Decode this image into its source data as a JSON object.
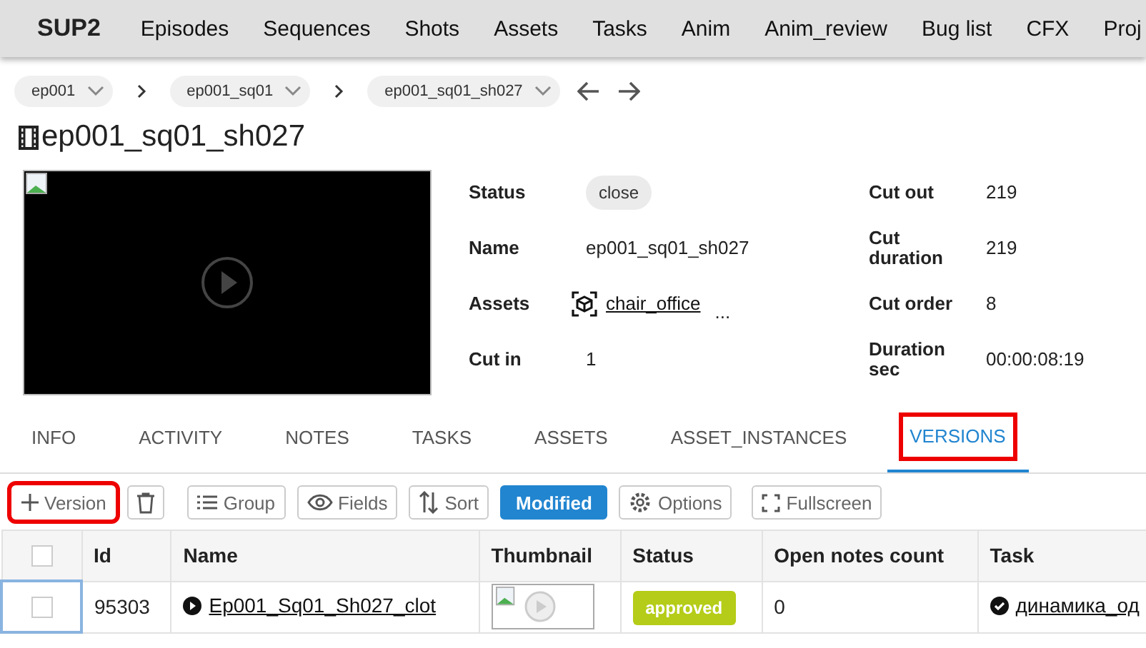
{
  "nav": {
    "brand": "SUP2",
    "items": [
      "Episodes",
      "Sequences",
      "Shots",
      "Assets",
      "Tasks",
      "Anim",
      "Anim_review",
      "Bug list",
      "CFX",
      "Proj"
    ]
  },
  "breadcrumbs": [
    "ep001",
    "ep001_sq01",
    "ep001_sq01_sh027"
  ],
  "title": "ep001_sq01_sh027",
  "info": {
    "left": [
      {
        "label": "Status",
        "kind": "chip",
        "value": "close"
      },
      {
        "label": "Name",
        "kind": "text",
        "value": "ep001_sq01_sh027"
      },
      {
        "label": "Assets",
        "kind": "asset",
        "value": "chair_office",
        "more": "..."
      },
      {
        "label": "Cut in",
        "kind": "text",
        "value": "1"
      }
    ],
    "right": [
      {
        "label": "Cut out",
        "value": "219"
      },
      {
        "label": "Cut duration",
        "value": "219"
      },
      {
        "label": "Cut order",
        "value": "8"
      },
      {
        "label": "Duration sec",
        "value": "00:00:08:19"
      }
    ]
  },
  "tabs": [
    {
      "label": "INFO",
      "selected": false,
      "highlighted": false
    },
    {
      "label": "ACTIVITY",
      "selected": false,
      "highlighted": false
    },
    {
      "label": "NOTES",
      "selected": false,
      "highlighted": false
    },
    {
      "label": "TASKS",
      "selected": false,
      "highlighted": false
    },
    {
      "label": "ASSETS",
      "selected": false,
      "highlighted": false
    },
    {
      "label": "ASSET_INSTANCES",
      "selected": false,
      "highlighted": false
    },
    {
      "label": "VERSIONS",
      "selected": true,
      "highlighted": true
    }
  ],
  "toolbar": [
    {
      "kind": "add",
      "label": "Version",
      "highlighted": true,
      "active": false
    },
    {
      "kind": "delete",
      "highlighted": false,
      "active": false
    },
    {
      "kind": "group",
      "label": "Group",
      "highlighted": false,
      "active": false
    },
    {
      "kind": "fields",
      "label": "Fields",
      "highlighted": false,
      "active": false
    },
    {
      "kind": "sort",
      "label": "Sort",
      "highlighted": false,
      "active": false
    },
    {
      "kind": "plain",
      "label": "Modified",
      "highlighted": false,
      "active": true
    },
    {
      "kind": "options",
      "label": "Options",
      "highlighted": false,
      "active": false
    },
    {
      "kind": "fullscreen",
      "label": "Fullscreen",
      "highlighted": false,
      "active": false
    }
  ],
  "table": {
    "all_checked": false,
    "columns": [
      "Id",
      "Name",
      "Thumbnail",
      "Status",
      "Open notes count",
      "Task"
    ],
    "rows": [
      {
        "checked": false,
        "id": "95303",
        "name": "Ep001_Sq01_Sh027_clot",
        "status": "approved",
        "color": "#b5cc18",
        "notes": "0",
        "task": "динамика_од"
      }
    ]
  }
}
